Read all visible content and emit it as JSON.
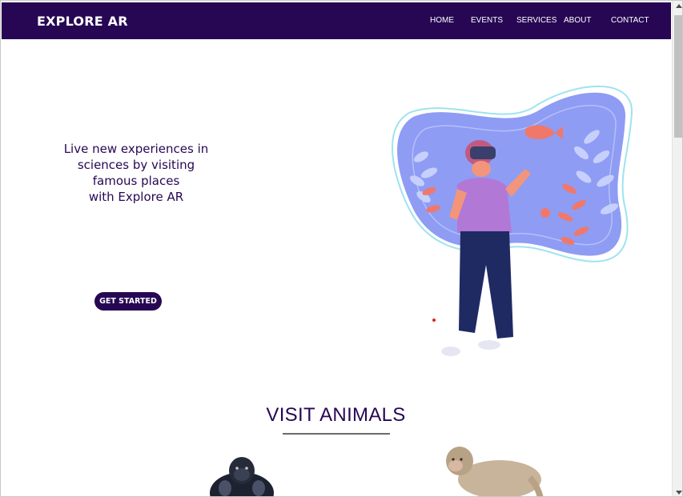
{
  "navbar": {
    "brand": "EXPLORE AR",
    "links": [
      {
        "label": "HOME"
      },
      {
        "label": "EVENTS"
      },
      {
        "label": "SERVICES"
      },
      {
        "label": "ABOUT"
      },
      {
        "label": "CONTACT"
      }
    ],
    "bg_color": "#270754"
  },
  "hero": {
    "lines": [
      "Live new experiences in",
      "sciences by visiting",
      "famous places",
      "with Explore AR"
    ],
    "cta_label": "GET STARTED",
    "illustration": "vr-headset-person-illustration"
  },
  "animals_section": {
    "title": "VISIT ANIMALS",
    "items": [
      {
        "icon": "gorilla-image"
      },
      {
        "icon": "monkey-image"
      }
    ]
  },
  "colors": {
    "primary": "#270754",
    "blob": "#8e9cf4",
    "accent": "#f0786a"
  }
}
